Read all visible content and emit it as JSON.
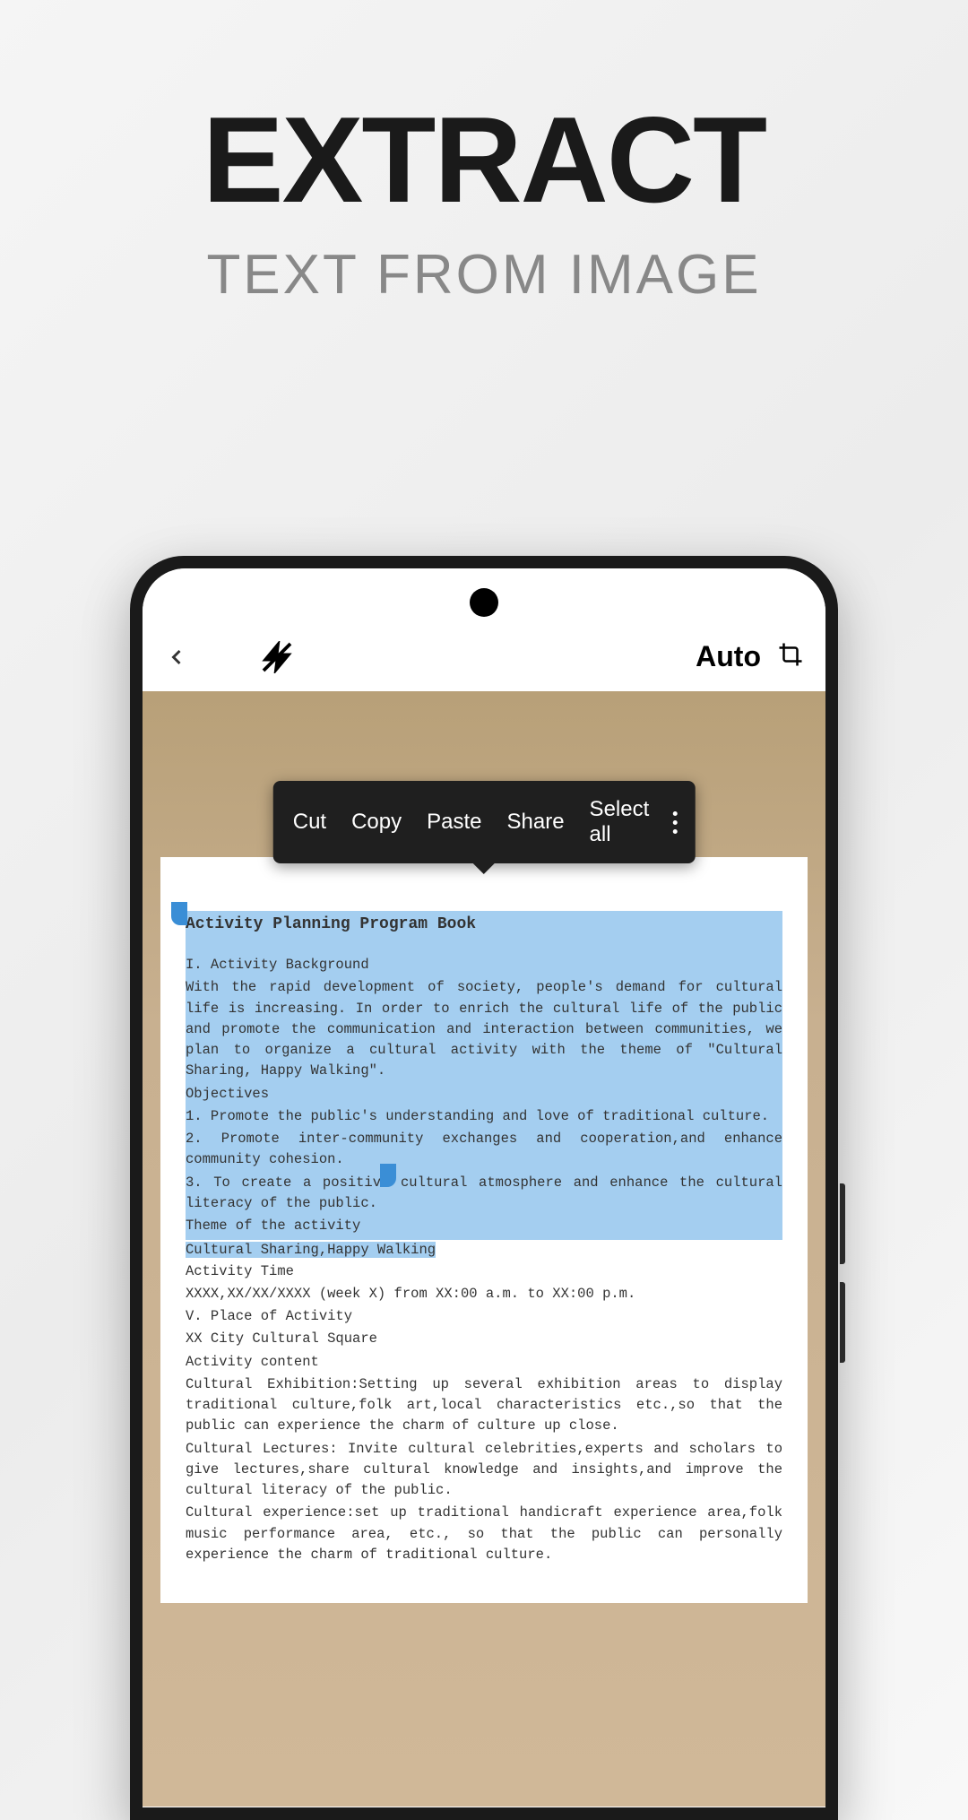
{
  "hero": {
    "title": "EXTRACT",
    "subtitle": "TEXT FROM IMAGE"
  },
  "toolbar": {
    "auto_label": "Auto"
  },
  "context_menu": {
    "cut": "Cut",
    "copy": "Copy",
    "paste": "Paste",
    "share": "Share",
    "select_all": "Select all"
  },
  "document": {
    "title": "Activity Planning Program Book",
    "section1_header": "I. Activity Background",
    "para1": "With the rapid development of society, people's demand for cultural life is increasing. In order to enrich the cultural life of the public and promote the communication and interaction between communities, we plan to organize a cultural activity with the theme of \"Cultural Sharing, Happy Walking\".",
    "objectives_label": "Objectives",
    "obj1": "1. Promote the public's understanding and love of traditional culture.",
    "obj2": "2. Promote inter-community exchanges and cooperation,and enhance community cohesion.",
    "obj3": "3. To create a positive cultural atmosphere and enhance the cultural literacy of the public.",
    "theme_label": "Theme of the activity",
    "theme_value": "Cultural Sharing,Happy Walking",
    "time_label": "Activity Time",
    "time_value": "XXXX,XX/XX/XXXX (week X) from XX:00 a.m. to XX:00 p.m.",
    "place_label": "V. Place of Activity",
    "place_value": "XX City Cultural Square",
    "content_label": "Activity content",
    "content1": "Cultural Exhibition:Setting up several exhibition areas to display traditional culture,folk art,local characteristics etc.,so that the public can experience the charm of culture up close.",
    "content2": "Cultural Lectures: Invite cultural celebrities,experts and scholars to give lectures,share cultural knowledge and insights,and improve the cultural literacy of the public.",
    "content3": "Cultural experience:set up traditional handicraft experience area,folk music performance area, etc., so that the public can personally experience the charm of traditional culture."
  }
}
